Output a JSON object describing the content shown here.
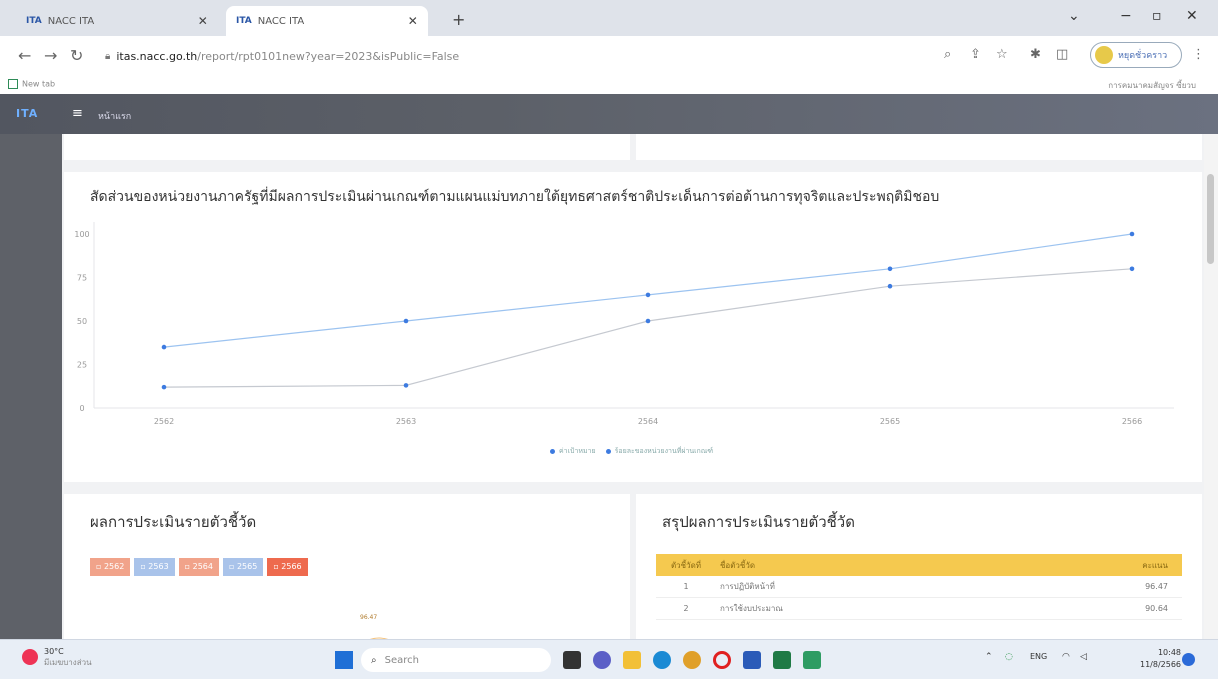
{
  "browser": {
    "tabs": [
      {
        "favicon_text": "ITA",
        "title": "NACC ITA",
        "active": false
      },
      {
        "favicon_text": "ITA",
        "title": "NACC ITA",
        "active": true
      }
    ],
    "url_host": "itas.nacc.go.th",
    "url_path": "/report/rpt0101new?year=2023&isPublic=False",
    "profile_label": "หยุดชั่วคราว",
    "bookmark": "New tab",
    "bookmark_user": "การคมนาคมสัญจร ซี้ยวบ"
  },
  "app": {
    "logo_prefix": "ITA",
    "home_link": "หน้าแรก"
  },
  "chart_section": {
    "title": "สัดส่วนของหน่วยงานภาครัฐที่มีผลการประเมินผ่านเกณฑ์ตามแผนแม่บทภายใต้ยุทธศาสตร์ชาติประเด็นการต่อต้านการทุจริตและประพฤติมิชอบ",
    "legend": [
      "ค่าเป้าหมาย",
      "ร้อยละของหน่วยงานที่ผ่านเกณฑ์"
    ]
  },
  "chart_data": {
    "type": "line",
    "title": "สัดส่วนของหน่วยงานภาครัฐที่มีผลการประเมินผ่านเกณฑ์ตามแผนแม่บทภายใต้ยุทธศาสตร์ชาติประเด็นการต่อต้านการทุจริตและประพฤติมิชอบ",
    "categories": [
      "2562",
      "2563",
      "2564",
      "2565",
      "2566"
    ],
    "series": [
      {
        "name": "ค่าเป้าหมาย",
        "values": [
          35,
          50,
          65,
          80,
          100
        ]
      },
      {
        "name": "ร้อยละของหน่วยงานที่ผ่านเกณฑ์",
        "values": [
          12,
          13,
          50,
          70,
          80
        ]
      }
    ],
    "yticks": [
      0,
      25,
      50,
      75,
      100
    ],
    "ylim": [
      0,
      100
    ],
    "colors": {
      "target_line": "#9cc3f0",
      "actual_line": "#c5c9d0",
      "point": "#3d7be0"
    },
    "legend_position": "bottom-center"
  },
  "indicator_section": {
    "title": "ผลการประเมินรายตัวชี้วัด",
    "chips": [
      {
        "label": "2562",
        "color": "#f1a38a"
      },
      {
        "label": "2563",
        "color": "#a9c3ea"
      },
      {
        "label": "2564",
        "color": "#f1a38a"
      },
      {
        "label": "2565",
        "color": "#a9c3ea"
      },
      {
        "label": "2566",
        "color": "#ee6a4e"
      }
    ],
    "center_value": "96.47"
  },
  "summary_section": {
    "title": "สรุปผลการประเมินรายตัวชี้วัด",
    "columns": [
      "ตัวชี้วัดที่",
      "ชื่อตัวชี้วัด",
      "คะแนน"
    ],
    "rows": [
      {
        "no": "1",
        "name": "การปฏิบัติหน้าที่",
        "score": "96.47"
      },
      {
        "no": "2",
        "name": "การใช้งบประมาณ",
        "score": "90.64"
      }
    ]
  },
  "taskbar": {
    "weather_temp": "30°C",
    "weather_desc": "มีเมฆบางส่วน",
    "search_placeholder": "Search",
    "lang": "ENG",
    "time": "10:48",
    "date": "11/8/2566"
  }
}
